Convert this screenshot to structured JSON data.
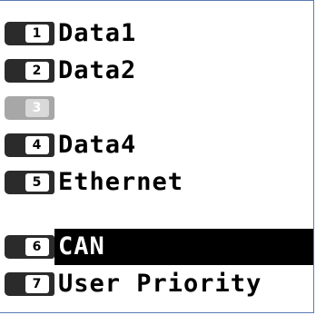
{
  "menu": {
    "items": [
      {
        "number": "1",
        "label": "Data1",
        "enabled": true,
        "selected": false
      },
      {
        "number": "2",
        "label": "Data2",
        "enabled": true,
        "selected": false
      },
      {
        "number": "3",
        "label": "",
        "enabled": false,
        "selected": false
      },
      {
        "number": "4",
        "label": "Data4",
        "enabled": true,
        "selected": false
      },
      {
        "number": "5",
        "label": "Ethernet",
        "enabled": true,
        "selected": false
      },
      {
        "number": "6",
        "label": "CAN",
        "enabled": true,
        "selected": true
      },
      {
        "number": "7",
        "label": "User Priority",
        "enabled": true,
        "selected": false
      }
    ]
  },
  "colors": {
    "border": "#5b7bb5",
    "selected_background": "#000000",
    "selected_text": "#ffffff",
    "badge": "#2b2b2b",
    "badge_disabled": "#a7a7a7"
  }
}
